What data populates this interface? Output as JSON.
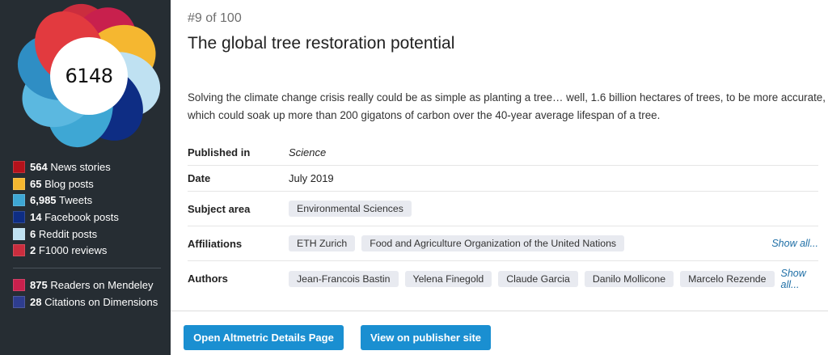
{
  "score": "6148",
  "colors": {
    "sidebar_bg": "#262d33",
    "button_bg": "#1a8fd1",
    "link": "#1f6fa6"
  },
  "sources": [
    {
      "count": "564",
      "label": "News stories",
      "color": "#b5121b"
    },
    {
      "count": "65",
      "label": "Blog posts",
      "color": "#f5b730"
    },
    {
      "count": "6,985",
      "label": "Tweets",
      "color": "#3ea7d4"
    },
    {
      "count": "14",
      "label": "Facebook posts",
      "color": "#0e2d84"
    },
    {
      "count": "6",
      "label": "Reddit posts",
      "color": "#bfe1f2"
    },
    {
      "count": "2",
      "label": "F1000 reviews",
      "color": "#cb2d3e"
    }
  ],
  "readers": [
    {
      "count": "875",
      "label": "Readers on Mendeley",
      "color": "#c8204d"
    },
    {
      "count": "28",
      "label": "Citations on Dimensions",
      "color": "#2e3d8f"
    }
  ],
  "article": {
    "rank": "#9 of 100",
    "title": "The global tree restoration potential",
    "summary": "Solving the climate change crisis really could be as simple as planting a tree… well, 1.6 billion hectares of trees, to be more accurate, which could soak up more than 200 gigatons of carbon over the 40-year average lifespan of a tree."
  },
  "meta": {
    "published_label": "Published in",
    "published_value": "Science",
    "date_label": "Date",
    "date_value": "July 2019",
    "subject_label": "Subject area",
    "subject_chips": [
      "Environmental Sciences"
    ],
    "affiliations_label": "Affiliations",
    "affiliation_chips": [
      "ETH Zurich",
      "Food and Agriculture Organization of the United Nations"
    ],
    "authors_label": "Authors",
    "author_chips": [
      "Jean-Francois Bastin",
      "Yelena Finegold",
      "Claude Garcia",
      "Danilo Mollicone",
      "Marcelo Rezende"
    ],
    "show_all": "Show all..."
  },
  "buttons": {
    "details": "Open Altmetric Details Page",
    "publisher": "View on publisher site"
  }
}
